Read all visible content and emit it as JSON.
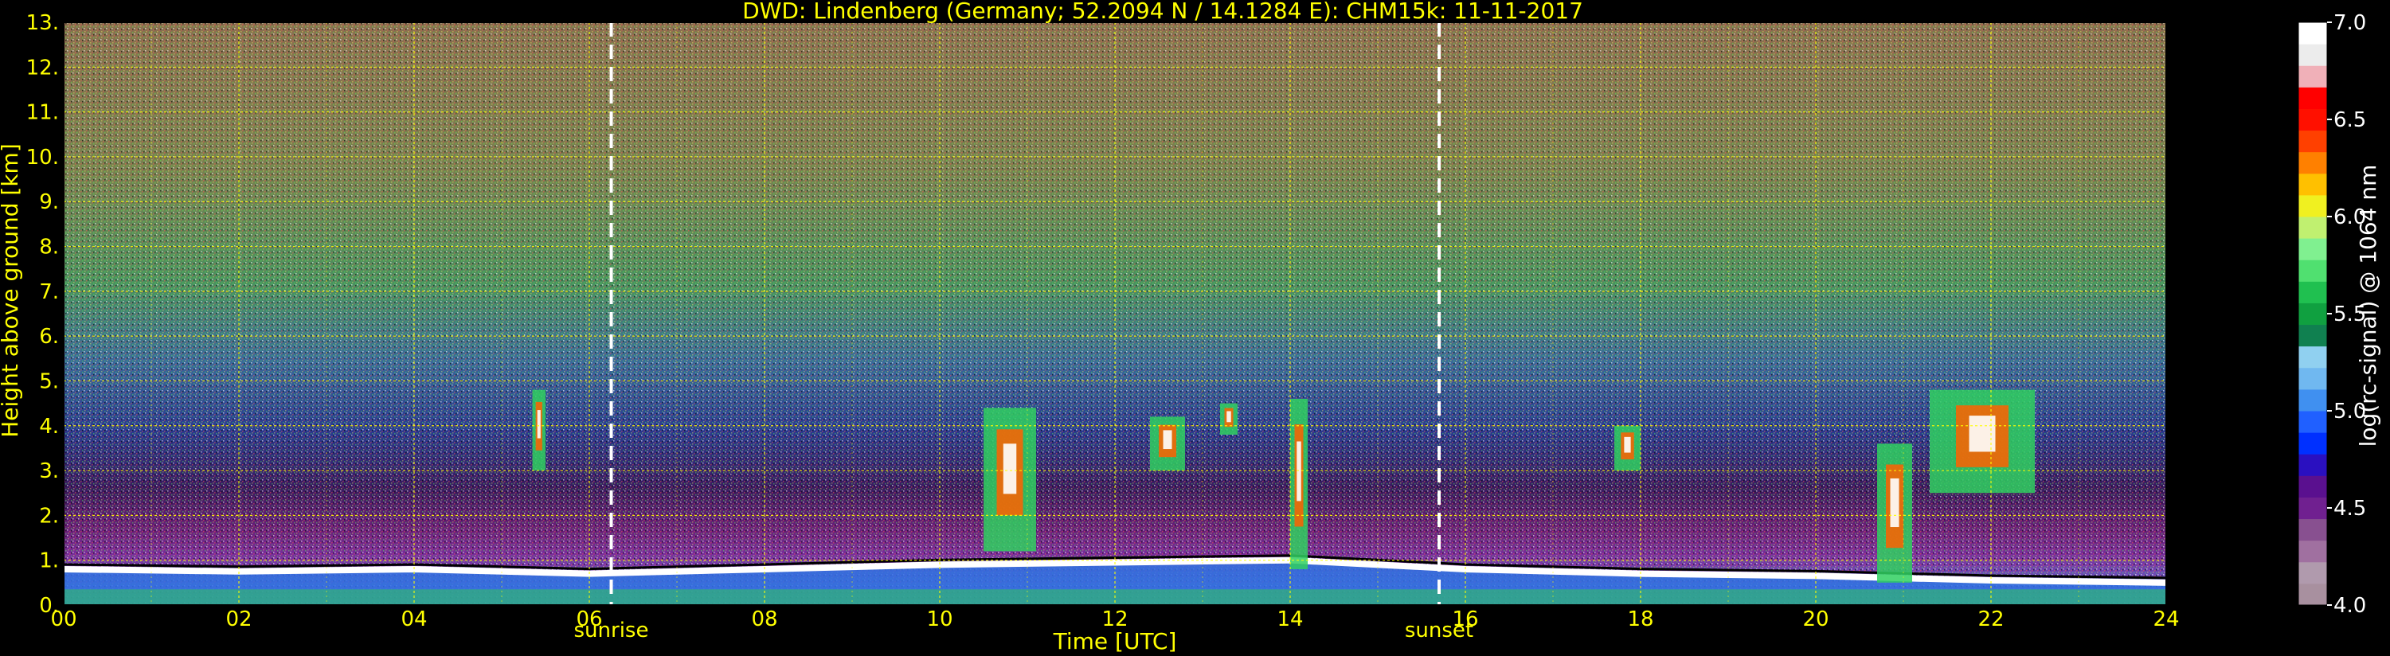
{
  "chart_data": {
    "type": "heatmap",
    "title": "DWD: Lindenberg (Germany; 52.2094 N / 14.1284 E):    CHM15k: 11-11-2017",
    "xlabel": "Time [UTC]",
    "ylabel": "Height above ground [km]",
    "xlim": [
      0,
      24
    ],
    "ylim": [
      0,
      13
    ],
    "x_ticks": [
      "00",
      "02",
      "04",
      "06",
      "08",
      "10",
      "12",
      "14",
      "16",
      "18",
      "20",
      "22",
      "24"
    ],
    "y_ticks": [
      "0.",
      "1.",
      "2.",
      "3.",
      "4.",
      "5.",
      "6.",
      "7.",
      "8.",
      "9.",
      "10.",
      "11.",
      "12.",
      "13."
    ],
    "grid": true,
    "grid_color": "#ffff00",
    "text_color": "#ffff00",
    "background": "#000000",
    "annotations": [
      {
        "label": "sunrise",
        "x": 6.25
      },
      {
        "label": "sunset",
        "x": 15.7
      }
    ],
    "colorbar": {
      "label": "log(rc-signal) @ 1064 nm",
      "range": [
        4.0,
        7.0
      ],
      "ticks": [
        "4.0",
        "4.5",
        "5.0",
        "5.5",
        "6.0",
        "6.5",
        "7.0"
      ],
      "colors": [
        "#a8909f",
        "#b09aad",
        "#a070a0",
        "#885090",
        "#702090",
        "#5a108f",
        "#2a10c0",
        "#0030ff",
        "#2060ff",
        "#4090f0",
        "#70b8f0",
        "#90d0f0",
        "#108050",
        "#10a040",
        "#20c050",
        "#50e070",
        "#80f090",
        "#c0f070",
        "#f0f020",
        "#ffc000",
        "#ff8000",
        "#ff4000",
        "#ff1000",
        "#ff0000",
        "#f0b0b8",
        "#ececec",
        "#ffffff"
      ]
    },
    "features": [
      {
        "name": "boundary layer top",
        "x": [
          0,
          2,
          4,
          6,
          8,
          10,
          12,
          14,
          16,
          18,
          20,
          22,
          24
        ],
        "height_km": [
          0.8,
          0.75,
          0.8,
          0.7,
          0.8,
          0.9,
          0.95,
          1.0,
          0.8,
          0.7,
          0.65,
          0.55,
          0.5
        ]
      },
      {
        "name": "cloud",
        "x0": 5.35,
        "x1": 5.5,
        "y0": 3.0,
        "y1": 4.8
      },
      {
        "name": "cloud",
        "x0": 10.5,
        "x1": 11.1,
        "y0": 1.2,
        "y1": 4.4
      },
      {
        "name": "cloud",
        "x0": 12.4,
        "x1": 12.8,
        "y0": 3.0,
        "y1": 4.2
      },
      {
        "name": "cloud",
        "x0": 13.2,
        "x1": 13.4,
        "y0": 3.8,
        "y1": 4.5
      },
      {
        "name": "cloud",
        "x0": 14.0,
        "x1": 14.2,
        "y0": 0.8,
        "y1": 4.6
      },
      {
        "name": "cloud",
        "x0": 17.7,
        "x1": 18.0,
        "y0": 3.0,
        "y1": 4.0
      },
      {
        "name": "cloud",
        "x0": 20.7,
        "x1": 21.1,
        "y0": 0.5,
        "y1": 3.6
      },
      {
        "name": "cloud",
        "x0": 21.3,
        "x1": 22.5,
        "y0": 2.5,
        "y1": 4.8
      }
    ]
  }
}
